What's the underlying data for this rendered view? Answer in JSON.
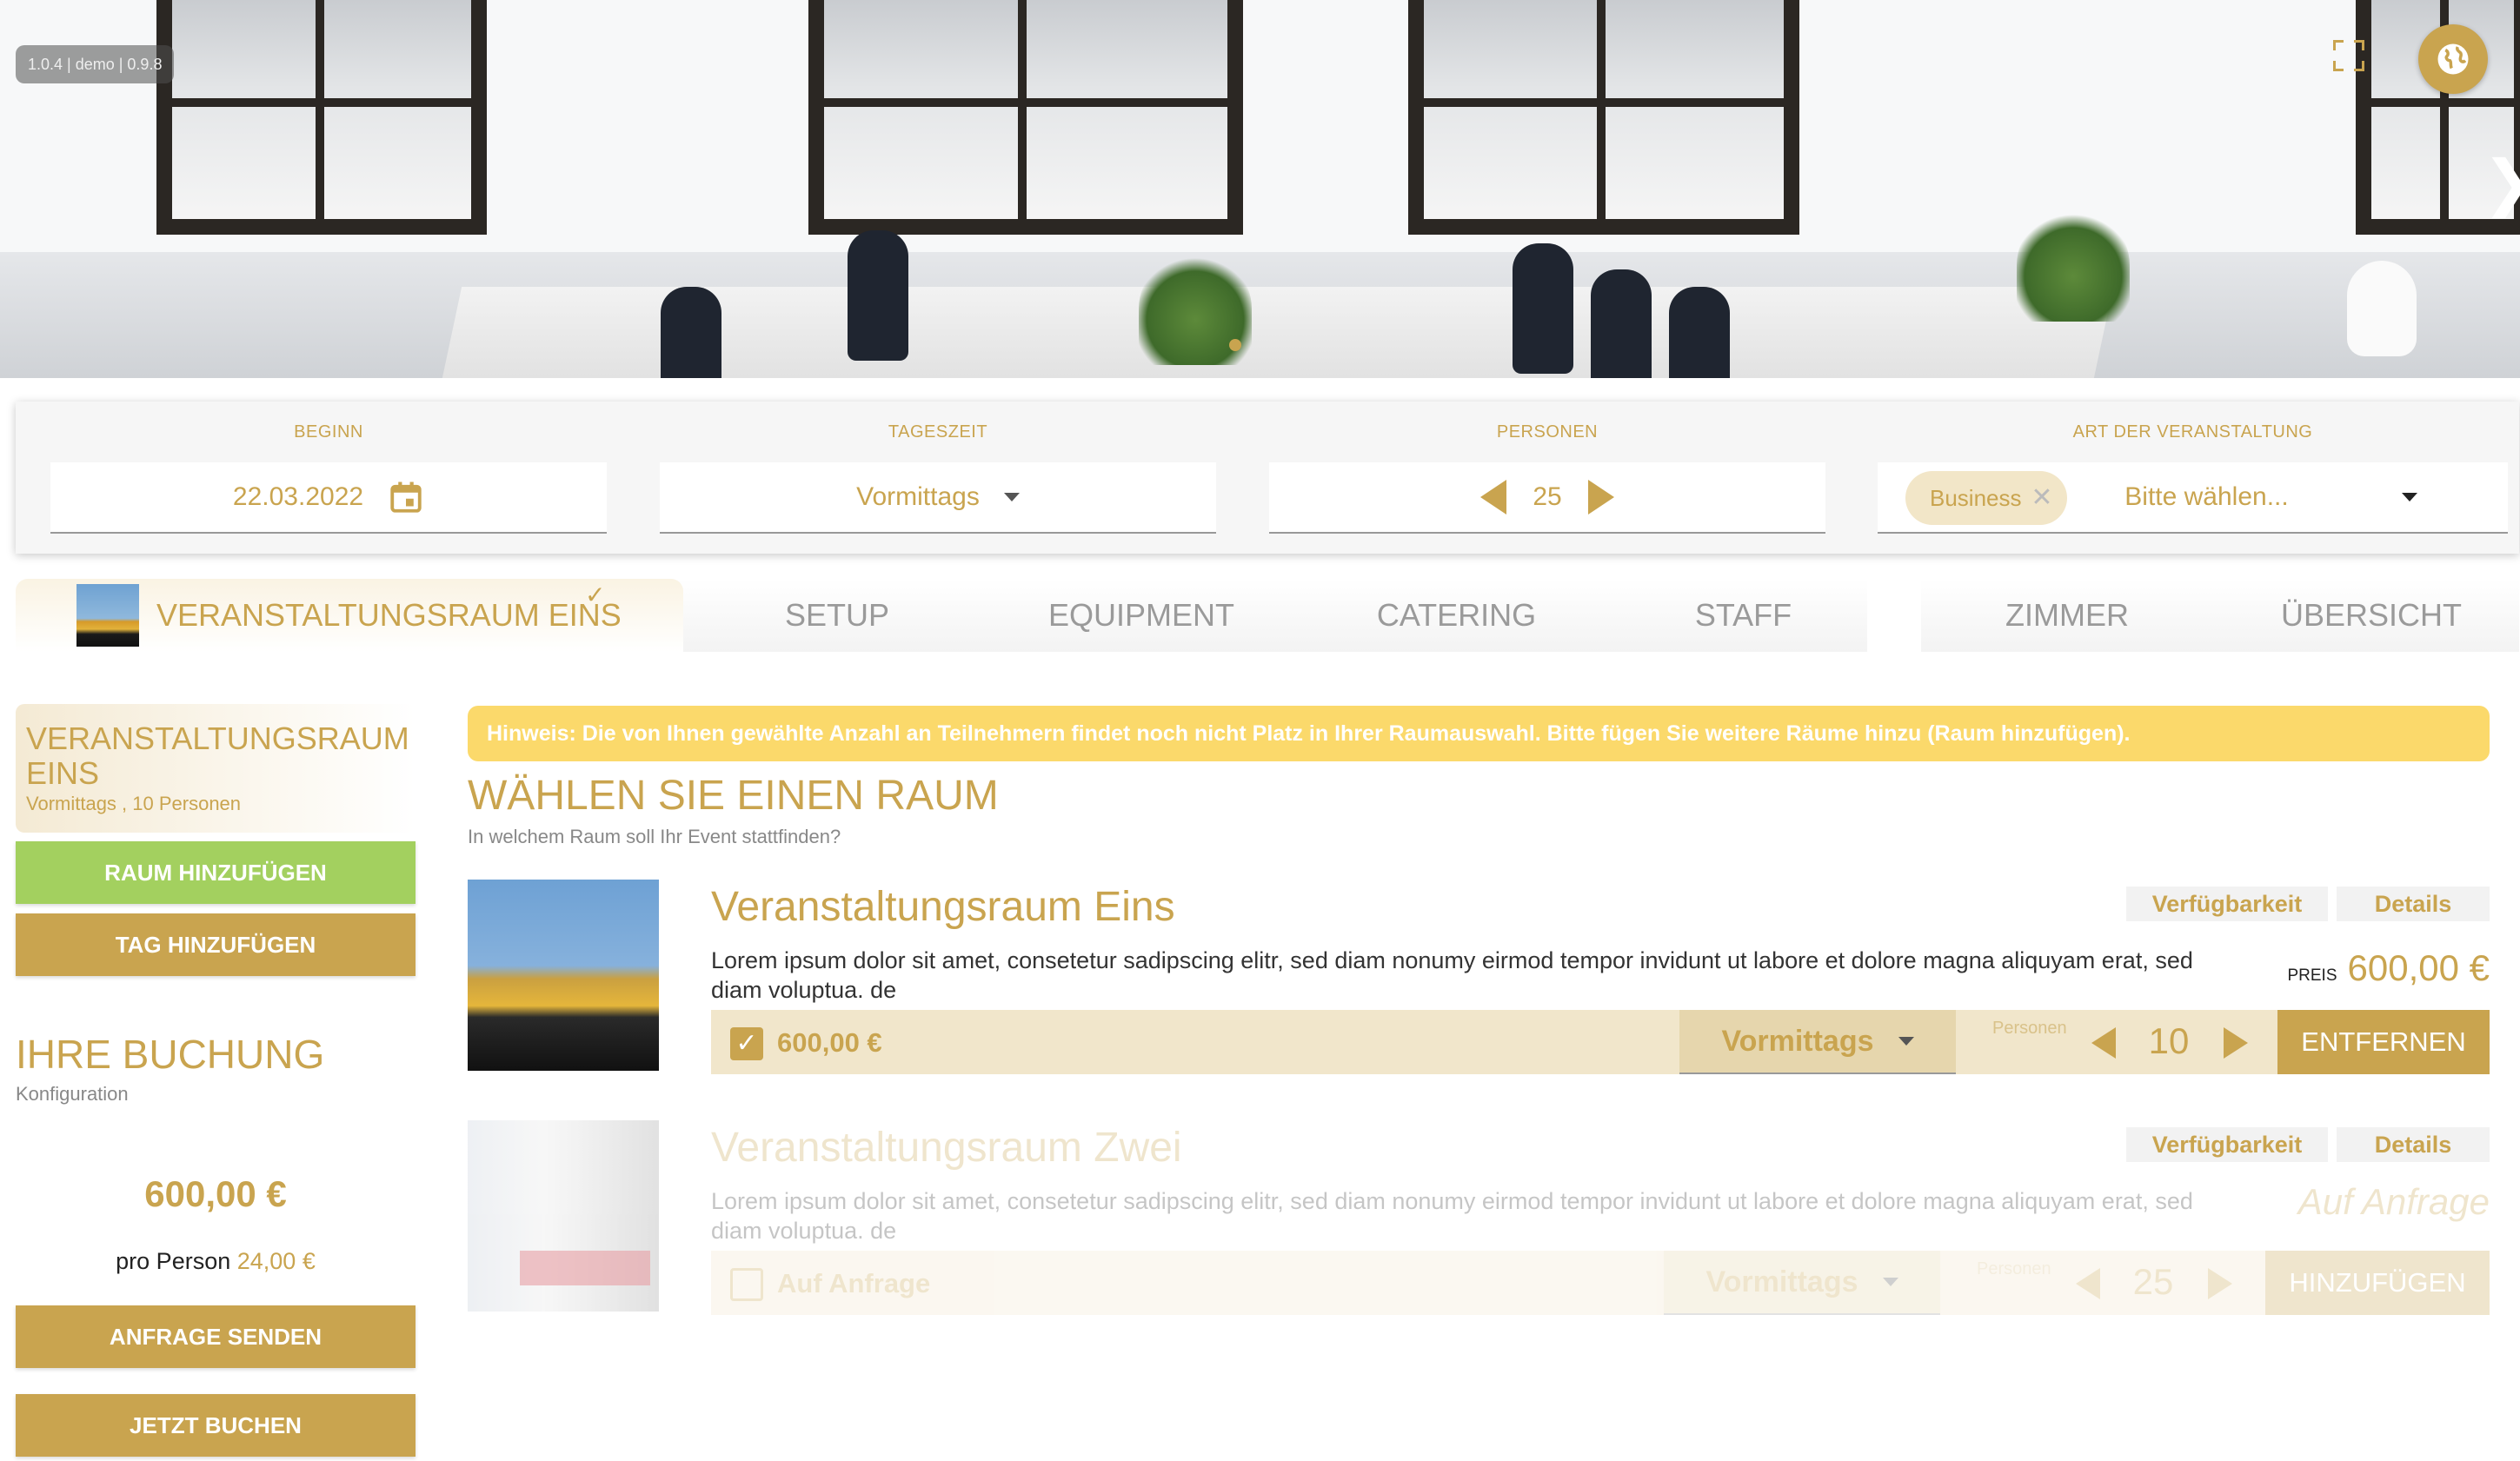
{
  "hero": {
    "version": "1.0.4 | demo | 0.9.8"
  },
  "filters": {
    "begin": {
      "label": "BEGINN",
      "value": "22.03.2022"
    },
    "daytime": {
      "label": "TAGESZEIT",
      "value": "Vormittags"
    },
    "persons": {
      "label": "PERSONEN",
      "value": "25"
    },
    "event_type": {
      "label": "ART DER VERANSTALTUNG",
      "chip": "Business",
      "placeholder": "Bitte wählen..."
    }
  },
  "tabs": [
    {
      "label": "VERANSTALTUNGSRAUM EINS"
    },
    {
      "label": "SETUP"
    },
    {
      "label": "EQUIPMENT"
    },
    {
      "label": "CATERING"
    },
    {
      "label": "STAFF"
    },
    {
      "label": "ZIMMER"
    },
    {
      "label": "ÜBERSICHT"
    }
  ],
  "sidebar": {
    "room_card": {
      "title": "VERANSTALTUNGSRAUM EINS",
      "subtitle": "Vormittags , 10 Personen"
    },
    "add_room": "RAUM HINZUFÜGEN",
    "add_day": "TAG HINZUFÜGEN",
    "booking_title": "IHRE BUCHUNG",
    "booking_sub": "Konfiguration",
    "total": "600,00 €",
    "per_person_label": "pro Person",
    "per_person_value": "24,00 €",
    "send_request": "ANFRAGE SENDEN",
    "book_now": "JETZT BUCHEN"
  },
  "main": {
    "notice": "Hinweis: Die von Ihnen gewählte Anzahl an Teilnehmern findet noch nicht Platz in Ihrer Raumauswahl. Bitte fügen Sie weitere Räume hinzu (Raum hinzufügen).",
    "title": "WÄHLEN SIE EINEN RAUM",
    "subtitle": "In welchem Raum soll Ihr Event stattfinden?",
    "rooms": [
      {
        "name": "Veranstaltungsraum Eins",
        "description": "Lorem ipsum dolor sit amet, consetetur sadipscing elitr, sed diam nonumy eirmod tempor invidunt ut labore et dolore magna aliquyam erat, sed diam voluptua. de",
        "availability": "Verfügbarkeit",
        "details": "Details",
        "price_label": "PREIS",
        "price": "600,00 €",
        "config_price": "600,00 €",
        "daytime": "Vormittags",
        "persons_label": "Personen",
        "persons": "10",
        "action": "ENTFERNEN",
        "selected": true
      },
      {
        "name": "Veranstaltungsraum Zwei",
        "description": "Lorem ipsum dolor sit amet, consetetur sadipscing elitr, sed diam nonumy eirmod tempor invidunt ut labore et dolore magna aliquyam erat, sed diam voluptua. de",
        "availability": "Verfügbarkeit",
        "details": "Details",
        "price": "Auf Anfrage",
        "config_price": "Auf Anfrage",
        "daytime": "Vormittags",
        "persons_label": "Personen",
        "persons": "25",
        "action": "HINZUFÜGEN",
        "selected": false
      }
    ]
  },
  "colors": {
    "accent": "#c9a44f",
    "accent_light": "#f1e6cb",
    "green": "#a3d05f",
    "notice": "#fbd96b"
  },
  "icons": [
    "fullscreen-icon",
    "globe-icon",
    "chevron-right-icon",
    "calendar-icon",
    "caret-down-icon",
    "arrow-left-icon",
    "arrow-right-icon",
    "close-icon",
    "check-icon"
  ]
}
